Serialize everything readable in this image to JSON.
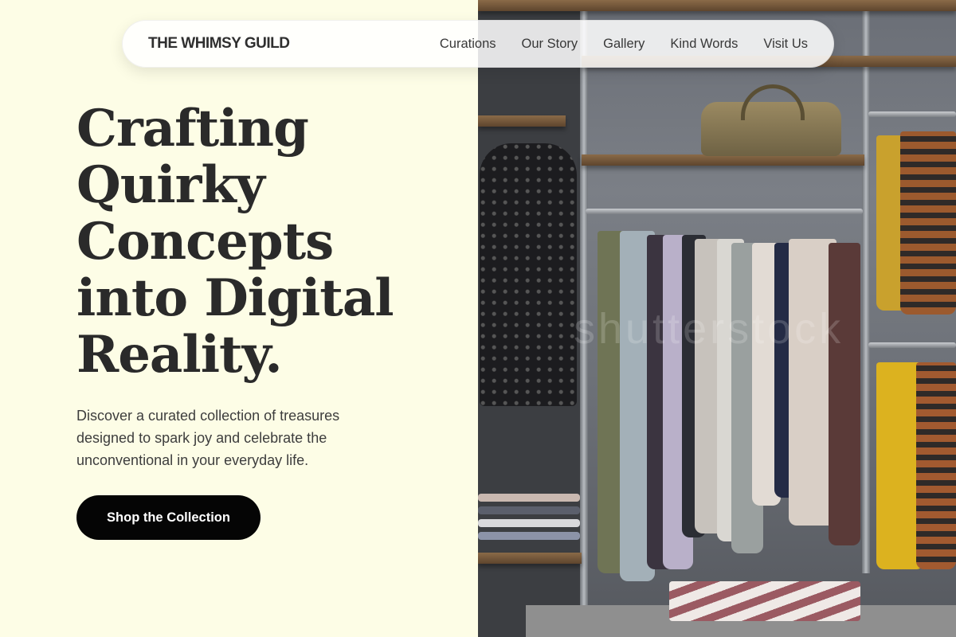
{
  "header": {
    "brand": "THE WHIMSY GUILD",
    "nav": [
      "Curations",
      "Our Story",
      "Gallery",
      "Kind Words",
      "Visit Us"
    ]
  },
  "hero": {
    "headline_lines": [
      "Crafting",
      "Quirky",
      "Concepts",
      "into Digital",
      "Reality."
    ],
    "subcopy": "Discover a curated collection of treasures designed to spark joy and celebrate the unconventional in your everyday life.",
    "cta_label": "Shop the Collection"
  },
  "photo": {
    "subject": "clothing-store-interior",
    "watermark": "shutterstock"
  },
  "colors": {
    "background": "#fdfde6",
    "text": "#2a2a2a",
    "cta_bg": "#050505",
    "cta_text": "#ffffff"
  }
}
